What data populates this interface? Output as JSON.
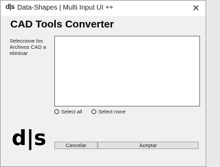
{
  "window": {
    "app_icon_text": "d|s",
    "title": "Data-Shapes | Multi Input UI ++",
    "close_glyph": "✕"
  },
  "main": {
    "heading": "CAD Tools Converter",
    "list_label": "Seleccione los Archivos CAD a eliminar",
    "list_items": [],
    "select_all_label": "Select all",
    "select_none_label": "Select none"
  },
  "footer": {
    "logo_text": "d|s",
    "cancel_label": "Cancelar",
    "accept_label": "Aceptar"
  }
}
